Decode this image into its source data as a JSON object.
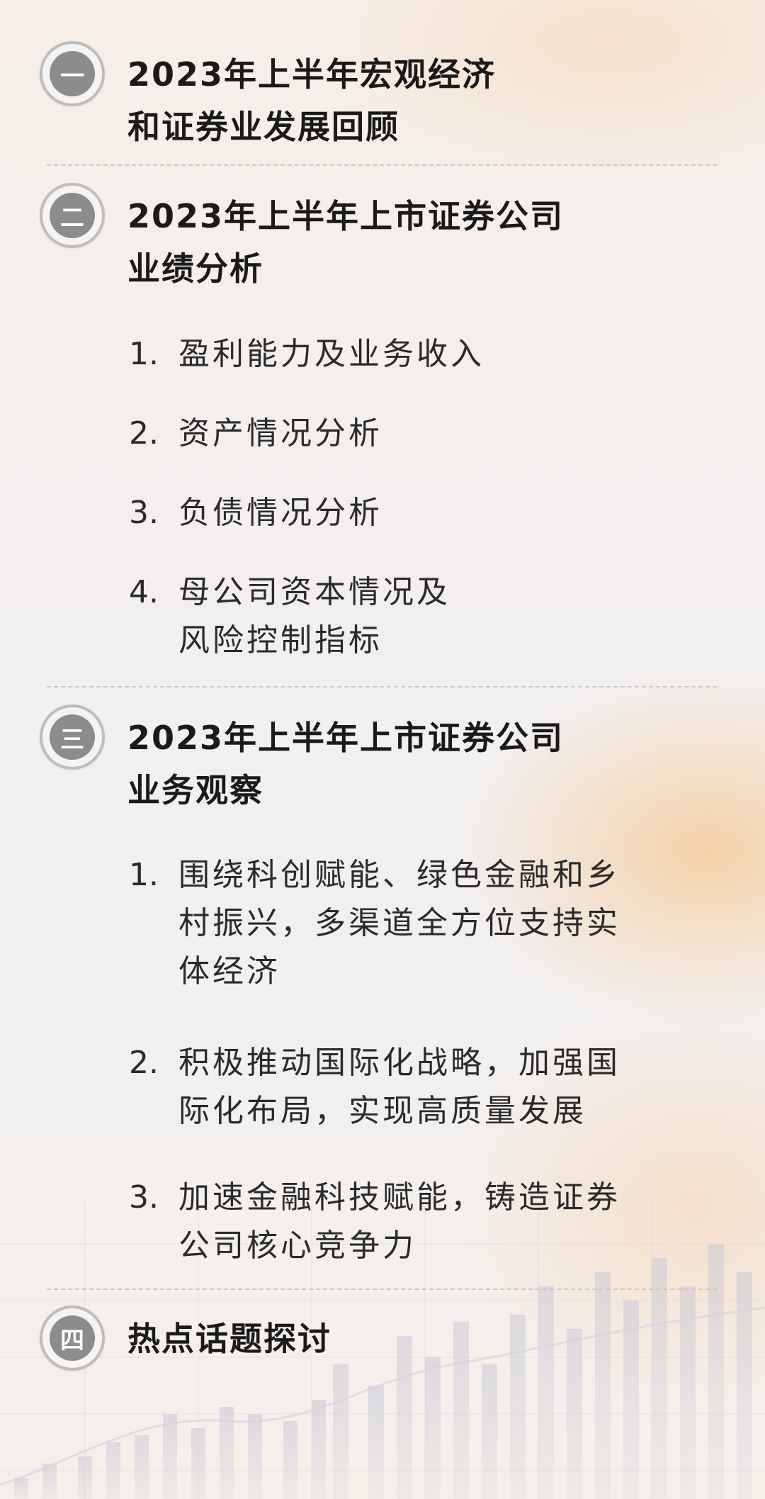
{
  "sections": [
    {
      "badge": "一",
      "title_lines": [
        "2023年上半年宏观经济",
        "和证券业发展回顾"
      ],
      "items": []
    },
    {
      "badge": "二",
      "title_lines": [
        "2023年上半年上市证券公司",
        "业绩分析"
      ],
      "items": [
        {
          "num": "1.",
          "lines": [
            "盈利能力及业务收入"
          ]
        },
        {
          "num": "2.",
          "lines": [
            "资产情况分析"
          ]
        },
        {
          "num": "3.",
          "lines": [
            "负债情况分析"
          ]
        },
        {
          "num": "4.",
          "lines": [
            "母公司资本情况及",
            "风险控制指标"
          ]
        }
      ]
    },
    {
      "badge": "三",
      "title_lines": [
        "2023年上半年上市证券公司",
        "业务观察"
      ],
      "items": [
        {
          "num": "1.",
          "lines": [
            "围绕科创赋能、绿色金融和乡",
            "村振兴，多渠道全方位支持实",
            "体经济"
          ]
        },
        {
          "num": "2.",
          "lines": [
            "积极推动国际化战略，加强国",
            "际化布局，实现高质量发展"
          ]
        },
        {
          "num": "3.",
          "lines": [
            "加速金融科技赋能，铸造证券",
            "公司核心竞争力"
          ]
        }
      ]
    },
    {
      "badge": "四",
      "title_lines": [
        "热点话题探讨"
      ],
      "items": []
    }
  ],
  "colors": {
    "badge_fill": "#8c8c8c",
    "badge_ring": "#bdbdbd",
    "text": "#1a1a1a",
    "accent_glow": "#fabA70"
  }
}
